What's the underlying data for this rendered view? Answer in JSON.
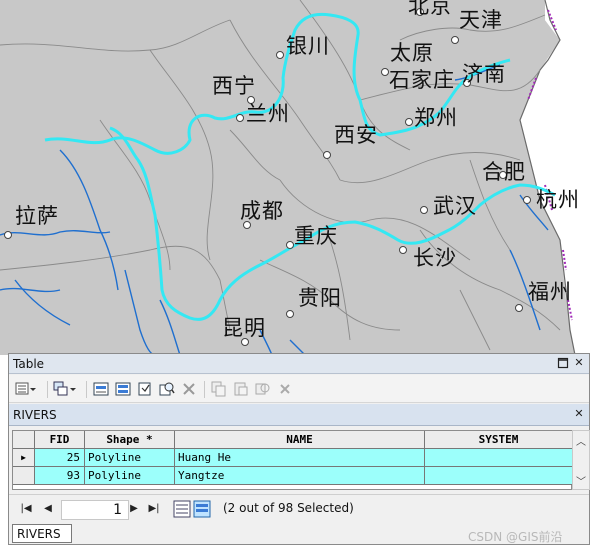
{
  "map": {
    "cities": [
      "北京",
      "天津",
      "银川",
      "太原",
      "石家庄",
      "济南",
      "西宁",
      "兰州",
      "郑州",
      "西安",
      "合肥",
      "杭州",
      "拉萨",
      "成都",
      "武汉",
      "重庆",
      "长沙",
      "贵阳",
      "福州",
      "昆明"
    ],
    "colors": {
      "land": "#c8c8c8",
      "boundary": "#8a8a8a",
      "highlighted_river": "#34e8f3",
      "other_river": "#1f6fcf",
      "coast_artifact": "#a12ab8"
    }
  },
  "table": {
    "window_title": "Table",
    "tab_name": "RIVERS",
    "bottom_tab": "RIVERS",
    "columns": [
      "FID",
      "Shape *",
      "NAME",
      "SYSTEM"
    ],
    "rows": [
      {
        "fid": "25",
        "shape": "Polyline",
        "name": "Huang He",
        "system": ""
      },
      {
        "fid": "93",
        "shape": "Polyline",
        "name": "Yangtze",
        "system": ""
      }
    ],
    "record_number": "1",
    "selection_status": "(2 out of 98 Selected)"
  },
  "watermark": "CSDN @GIS前沿"
}
